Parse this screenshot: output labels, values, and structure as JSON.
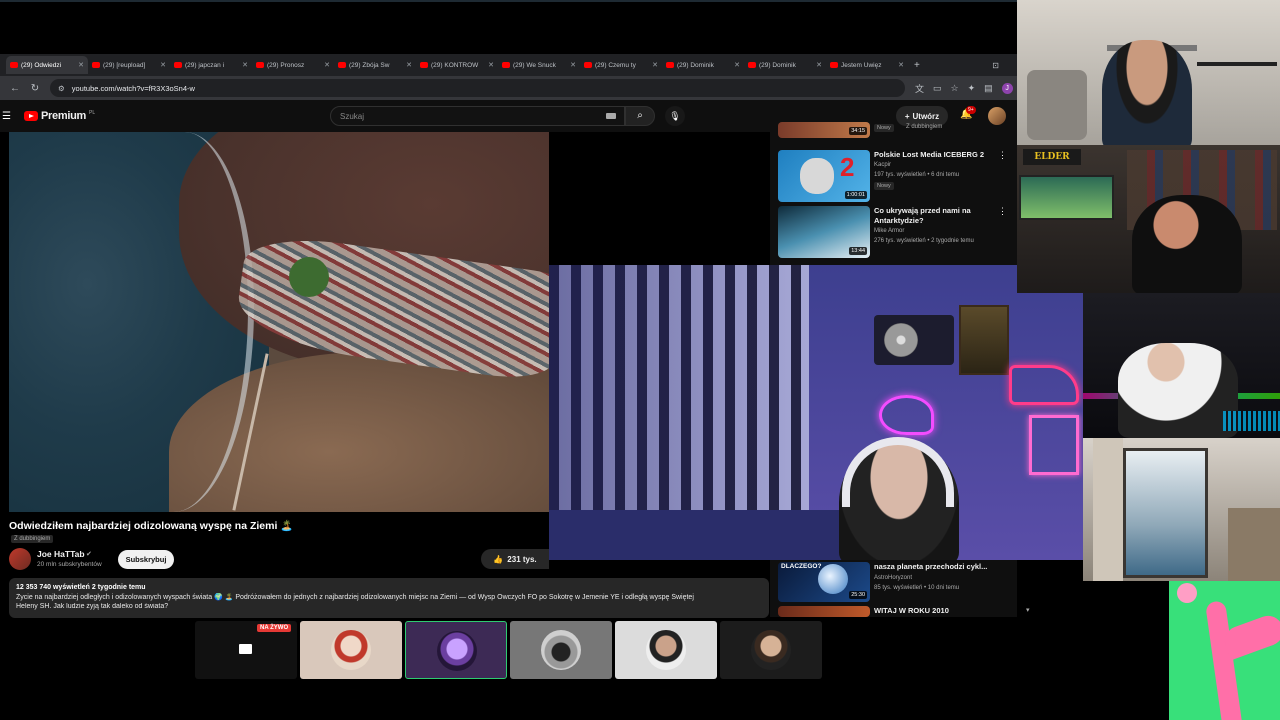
{
  "browser": {
    "tabs": [
      {
        "label": "(29) Odwiedzi",
        "active": true
      },
      {
        "label": "(29) [reupload]",
        "active": false
      },
      {
        "label": "(29) japczan i",
        "active": false
      },
      {
        "label": "(29) Pronosz",
        "active": false
      },
      {
        "label": "(29) Zbója Św",
        "active": false
      },
      {
        "label": "(29) KONTROW",
        "active": false
      },
      {
        "label": "(29) We Snuck",
        "active": false
      },
      {
        "label": "(29) Czemu ty",
        "active": false
      },
      {
        "label": "(29) Dominik",
        "active": false
      },
      {
        "label": "(29) Dominik",
        "active": false
      },
      {
        "label": "Jestem Uwięz",
        "active": false
      }
    ],
    "new_tab": "+",
    "url": "youtube.com/watch?v=fR3X3oSn4-w"
  },
  "youtube": {
    "logo_text": "Premium",
    "logo_country": "PL",
    "search_placeholder": "Szukaj",
    "create_label": "Utwórz",
    "notifications": "9+"
  },
  "video": {
    "title": "Odwiedziłem najbardziej odizolowaną wyspę na Ziemi 🏝️",
    "dub_badge": "Z dubbingiem",
    "channel": "Joe HaTTab",
    "subscribers": "20 mln subskrybentów",
    "subscribe_label": "Subskrybuj",
    "likes": "231 tys.",
    "stats": "12 353 740 wyświetleń  2 tygodnie temu",
    "description_1": "Życie na najbardziej odległych i odizolowanych wyspach świata 🌍 🏝️ Podróżowałem do jednych z najbardziej odizolowanych miejsc na Ziemi — od Wysp Owczych FO po Sokotrę w Jemenie YE i odległą wyspę Świętej",
    "description_2": "Heleny SH. Jak ludzie żyją tak daleko od świata?"
  },
  "recs": [
    {
      "title": "",
      "channel": "",
      "meta": "",
      "badge": "Nowy",
      "duration": "34:15",
      "extra": "Z dubbingiem"
    },
    {
      "title": "Polskie Lost Media ICEBERG 2",
      "channel": "Kacpir",
      "meta": "197 tys. wyświetleń • 6 dni temu",
      "badge": "Nowy",
      "duration": "1:00:01"
    },
    {
      "title": "Co ukrywają przed nami na Antarktydzie?",
      "channel": "Mike Armor",
      "meta": "276 tys. wyświetleń • 2 tygodnie temu",
      "duration": "13:44"
    },
    {
      "title": "nasza planeta przechodzi cykl...",
      "channel": "AstroHoryzont",
      "meta": "85 tys. wyświetleń • 10 dni temu",
      "duration": "25:30",
      "thumb_text": "DLACZEGO?"
    },
    {
      "title": "WITAJ W ROKU 2010",
      "channel": "",
      "meta": "",
      "duration": ""
    }
  ],
  "cams": {
    "cam2_logo": "ELDER"
  },
  "participants": {
    "live_badge": "NA ŻYWO"
  },
  "colors": {
    "yt_red": "#ff0000",
    "bg": "#0f0f0f",
    "live_red": "#e53935"
  }
}
